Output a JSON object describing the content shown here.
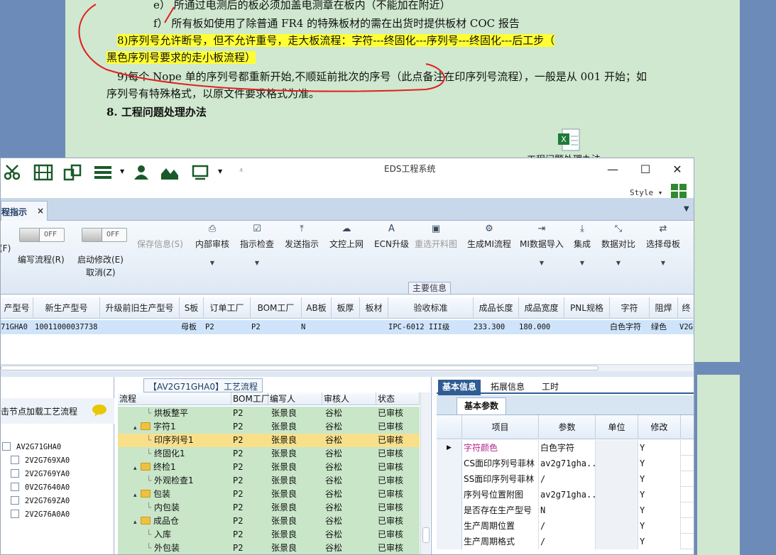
{
  "document": {
    "line_e": "e） 所通过电测后的板必须加盖电测章在板内（不能加在附近）",
    "line_f": "f） 所有板如使用了除普通 FR4 的特殊板材的需在出货时提供板材 COC 报告",
    "item8_a": "8)序列号允许断号，但不允许重号，走大板流程：字符---终固化---序列号---终固化---后工步（",
    "item8_b": "黑色序列号要求的走小板流程）",
    "item9_a": "9)每个 Nope 单的序列号都重新开始,不顺延前批次的序号（此点备注在印序列号流程），一般是从 001 开始；如",
    "item9_b": "序列号有特殊格式，以原文件要求格式为准。",
    "heading8": "8. 工程问题处理办法",
    "embedded_file_label": "工程问题处理办法"
  },
  "app": {
    "title": "EDS工程系统",
    "style_label": "Style",
    "colors": {
      "tab_bg": "#c8d8ea",
      "row_green": "#c9e6c9",
      "row_selected": "#f8e08a",
      "accent": "#2e5d94"
    }
  },
  "tabs": [
    {
      "label": "程指示",
      "close": "×"
    }
  ],
  "ribbon": {
    "toggles": [
      {
        "state": "OFF"
      },
      {
        "state": "OFF"
      }
    ],
    "left_labels": {
      "f": "(F)",
      "write_flow": "编写流程(R)",
      "start_edit": "启动修改(E)",
      "cancel": "取消(Z)"
    },
    "buttons": [
      {
        "label": "保存信息(S)",
        "icon": "save-icon"
      },
      {
        "label": "内部审核",
        "icon": "print-icon"
      },
      {
        "label": "指示检查",
        "icon": "check-icon"
      },
      {
        "label": "发送指示",
        "icon": "upload-icon"
      },
      {
        "label": "文控上网",
        "icon": "cloud-icon"
      },
      {
        "label": "ECN升级",
        "icon": "ecn-icon"
      },
      {
        "label": "重选开料图",
        "icon": "image-icon"
      },
      {
        "label": "生成MI流程",
        "icon": "gears-icon"
      },
      {
        "label": "MI数据导入",
        "icon": "import-icon"
      },
      {
        "label": "集成",
        "icon": "download-icon"
      },
      {
        "label": "数据对比",
        "icon": "compare-icon"
      },
      {
        "label": "选择母板",
        "icon": "shuffle-icon"
      }
    ],
    "group_label": "主要信息"
  },
  "main_grid": {
    "headers": [
      "产型号",
      "新生产型号",
      "升级前旧生产型号",
      "S板",
      "订单工厂",
      "BOM工厂",
      "AB板",
      "板厚",
      "板材",
      "验收标准",
      "成品长度",
      "成品宽度",
      "PNL规格",
      "字符",
      "阻焊",
      "终"
    ],
    "row": [
      "71GHA0",
      "10011000037738",
      "",
      "母板",
      "P2",
      "P2",
      "N",
      "",
      "",
      "IPC-6012 III级",
      "233.300",
      "180.000",
      "",
      "白色字符",
      "绿色",
      "V2G"
    ]
  },
  "left_panel": {
    "title": "击节点加载工艺流程",
    "root": "AV2G71GHA0",
    "children": [
      "2V2G769XA0",
      "2V2G769YA0",
      "0V2G7640A0",
      "2V2G769ZA0",
      "2V2G76A0A0"
    ]
  },
  "process": {
    "caption": "【AV2G71GHA0】工艺流程",
    "headers": [
      "流程",
      "BOM工厂",
      "编写人",
      "审核人",
      "状态"
    ],
    "rows": [
      {
        "name": "烘板整平",
        "level": 2,
        "folder": false,
        "factory": "P2",
        "writer": "张景良",
        "reviewer": "谷松",
        "status": "已审核"
      },
      {
        "name": "字符1",
        "level": 1,
        "folder": true,
        "factory": "P2",
        "writer": "张景良",
        "reviewer": "谷松",
        "status": "已审核"
      },
      {
        "name": "印序列号1",
        "level": 2,
        "folder": false,
        "factory": "P2",
        "writer": "张景良",
        "reviewer": "谷松",
        "status": "已审核",
        "selected": true
      },
      {
        "name": "终固化1",
        "level": 2,
        "folder": false,
        "factory": "P2",
        "writer": "张景良",
        "reviewer": "谷松",
        "status": "已审核"
      },
      {
        "name": "终检1",
        "level": 1,
        "folder": true,
        "factory": "P2",
        "writer": "张景良",
        "reviewer": "谷松",
        "status": "已审核"
      },
      {
        "name": "外观检查1",
        "level": 2,
        "folder": false,
        "factory": "P2",
        "writer": "张景良",
        "reviewer": "谷松",
        "status": "已审核"
      },
      {
        "name": "包装",
        "level": 1,
        "folder": true,
        "factory": "P2",
        "writer": "张景良",
        "reviewer": "谷松",
        "status": "已审核"
      },
      {
        "name": "内包装",
        "level": 2,
        "folder": false,
        "factory": "P2",
        "writer": "张景良",
        "reviewer": "谷松",
        "status": "已审核"
      },
      {
        "name": "成品仓",
        "level": 1,
        "folder": true,
        "factory": "P2",
        "writer": "张景良",
        "reviewer": "谷松",
        "status": "已审核"
      },
      {
        "name": "入库",
        "level": 2,
        "folder": false,
        "factory": "P2",
        "writer": "张景良",
        "reviewer": "谷松",
        "status": "已审核"
      },
      {
        "name": "外包装",
        "level": 2,
        "folder": false,
        "factory": "P2",
        "writer": "张景良",
        "reviewer": "谷松",
        "status": "已审核"
      }
    ]
  },
  "right_panel": {
    "tabs": [
      "基本信息",
      "拓展信息",
      "工时"
    ],
    "subtab": "基本参数",
    "headers": [
      "项目",
      "参数",
      "单位",
      "修改"
    ],
    "rows": [
      {
        "item": "字符颜色",
        "value": "白色字符",
        "unit": "",
        "edit": "Y",
        "current": true
      },
      {
        "item": "CS面印序列号菲林",
        "value": "av2g71gha...",
        "unit": "",
        "edit": "Y"
      },
      {
        "item": "SS面印序列号菲林",
        "value": "/",
        "unit": "",
        "edit": "Y"
      },
      {
        "item": "序列号位置附图",
        "value": "av2g71gha...",
        "unit": "",
        "edit": "Y"
      },
      {
        "item": "是否存在生产型号",
        "value": "N",
        "unit": "",
        "edit": "Y"
      },
      {
        "item": "生产周期位置",
        "value": "/",
        "unit": "",
        "edit": "Y"
      },
      {
        "item": "生产周期格式",
        "value": "/",
        "unit": "",
        "edit": "Y"
      }
    ]
  }
}
